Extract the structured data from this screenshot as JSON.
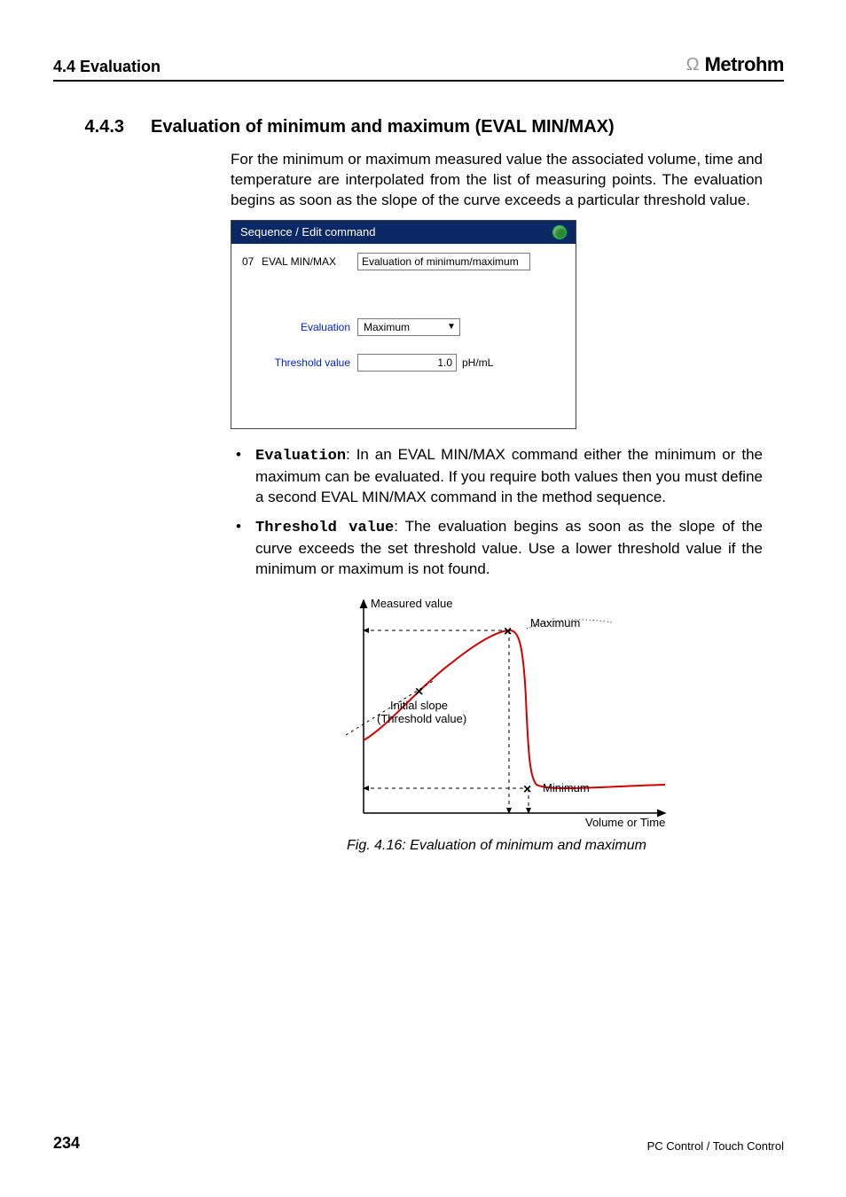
{
  "header": {
    "section": "4.4 Evaluation",
    "brand": "Metrohm"
  },
  "heading": {
    "num": "4.4.3",
    "title": "Evaluation of minimum and maximum (EVAL MIN/MAX)"
  },
  "intro": "For the minimum or maximum measured value the associated volume, time and temperature are interpolated from the list of measuring points. The evaluation begins as soon as the slope of the curve exceeds a particular threshold value.",
  "dialog": {
    "title": "Sequence / Edit command",
    "step_no": "07",
    "step_name": "EVAL MIN/MAX",
    "step_desc": "Evaluation of minimum/maximum",
    "field_evaluation_label": "Evaluation",
    "field_evaluation_value": "Maximum",
    "field_threshold_label": "Threshold value",
    "field_threshold_value": "1.0",
    "field_threshold_unit": "pH/mL"
  },
  "bullets": {
    "b1_kw": "Evaluation",
    "b1_text": ": In an EVAL MIN/MAX command either the minimum or the maximum can be evaluated. If you require both values then you must define a second EVAL MIN/MAX command in the method sequence.",
    "b2_kw": "Threshold value",
    "b2_text": ": The evaluation begins as soon as the slope of the curve exceeds the set threshold value. Use a lower threshold value if the minimum or maximum is not found."
  },
  "figure": {
    "y_axis": "Measured value",
    "x_axis": "Volume or Time",
    "label_max": "Maximum",
    "label_min": "Minimum",
    "label_slope_l1": "Initial slope",
    "label_slope_l2": "(Threshold value)",
    "caption": "Fig. 4.16: Evaluation of minimum and maximum"
  },
  "footer": {
    "page": "234",
    "label": "PC Control / Touch Control"
  }
}
